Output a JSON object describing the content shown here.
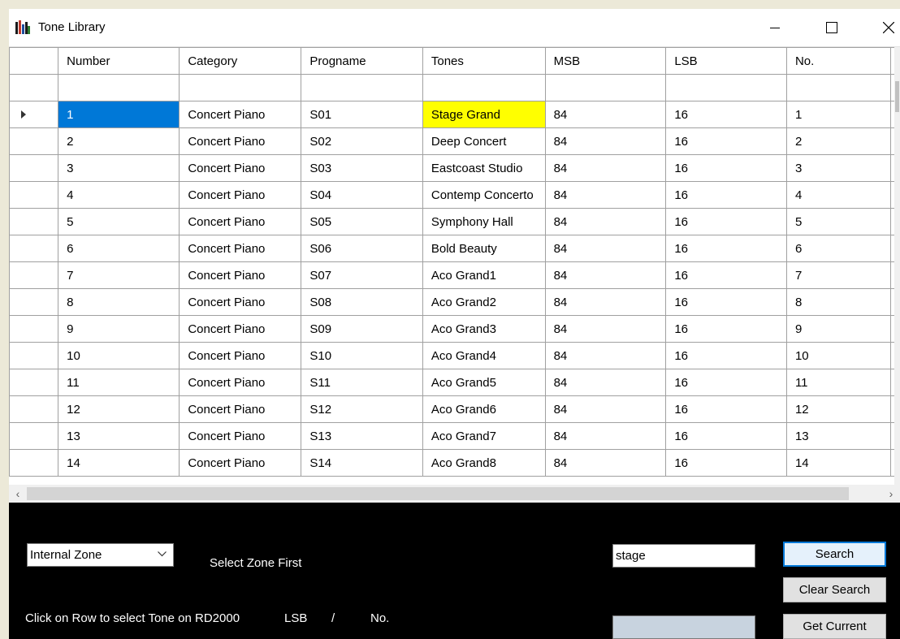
{
  "window": {
    "title": "Tone Library",
    "controls": {
      "minimize": "minimize-icon",
      "maximize": "maximize-icon",
      "close": "close-icon"
    }
  },
  "grid": {
    "columns": [
      "Number",
      "Category",
      "Progname",
      "Tones",
      "MSB",
      "LSB",
      "No."
    ],
    "rows": [
      [
        "1",
        "Concert Piano",
        "S01",
        "Stage Grand",
        "84",
        "16",
        "1"
      ],
      [
        "2",
        "Concert Piano",
        "S02",
        "Deep Concert",
        "84",
        "16",
        "2"
      ],
      [
        "3",
        "Concert Piano",
        "S03",
        "Eastcoast Studio",
        "84",
        "16",
        "3"
      ],
      [
        "4",
        "Concert Piano",
        "S04",
        "Contemp Concerto",
        "84",
        "16",
        "4"
      ],
      [
        "5",
        "Concert Piano",
        "S05",
        "Symphony Hall",
        "84",
        "16",
        "5"
      ],
      [
        "6",
        "Concert Piano",
        "S06",
        "Bold Beauty",
        "84",
        "16",
        "6"
      ],
      [
        "7",
        "Concert Piano",
        "S07",
        "Aco Grand1",
        "84",
        "16",
        "7"
      ],
      [
        "8",
        "Concert Piano",
        "S08",
        "Aco Grand2",
        "84",
        "16",
        "8"
      ],
      [
        "9",
        "Concert Piano",
        "S09",
        "Aco Grand3",
        "84",
        "16",
        "9"
      ],
      [
        "10",
        "Concert Piano",
        "S10",
        "Aco Grand4",
        "84",
        "16",
        "10"
      ],
      [
        "11",
        "Concert Piano",
        "S11",
        "Aco Grand5",
        "84",
        "16",
        "11"
      ],
      [
        "12",
        "Concert Piano",
        "S12",
        "Aco Grand6",
        "84",
        "16",
        "12"
      ],
      [
        "13",
        "Concert Piano",
        "S13",
        "Aco Grand7",
        "84",
        "16",
        "13"
      ],
      [
        "14",
        "Concert Piano",
        "S14",
        "Aco Grand8",
        "84",
        "16",
        "14"
      ]
    ],
    "selected_row": 0,
    "colors": {
      "selected": "#0078d7",
      "highlight": "#ffff00"
    }
  },
  "controls": {
    "zone_select_value": "Internal Zone",
    "select_zone_hint": "Select Zone First",
    "search_value": "stage",
    "current_value": "",
    "search_button": "Search",
    "clear_search_button": "Clear Search",
    "get_current_button": "Get Current",
    "help_text": "Click on Row to select Tone on RD2000",
    "lsb_label": "LSB",
    "slash_label": "/",
    "no_label": "No."
  }
}
